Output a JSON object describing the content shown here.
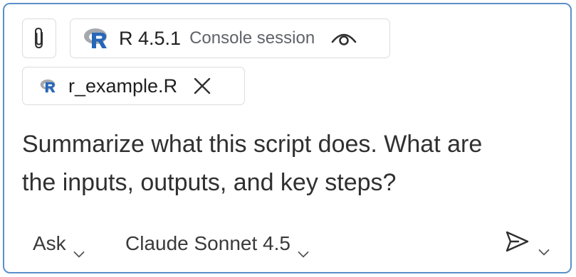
{
  "attachments": {
    "attach_icon": "paperclip-icon",
    "session": {
      "icon": "r-logo-icon",
      "version": "R 4.5.1",
      "type": "Console session",
      "visibility_icon": "eye-icon"
    },
    "file": {
      "icon": "r-logo-icon",
      "name": "r_example.R",
      "remove_icon": "close-icon"
    }
  },
  "prompt": {
    "line1": "Summarize what this script does. What are",
    "line2": "the inputs, outputs, and key steps?"
  },
  "toolbar": {
    "mode": "Ask",
    "model": "Claude Sonnet 4.5",
    "send_icon": "send-icon",
    "chevron_icon": "chevron-down-icon"
  },
  "colors": {
    "focus_border": "#5b8fc9",
    "r_logo_blue": "#2767b8",
    "r_logo_gray": "#a5a8ad",
    "chip_border": "#dcdcdc"
  }
}
